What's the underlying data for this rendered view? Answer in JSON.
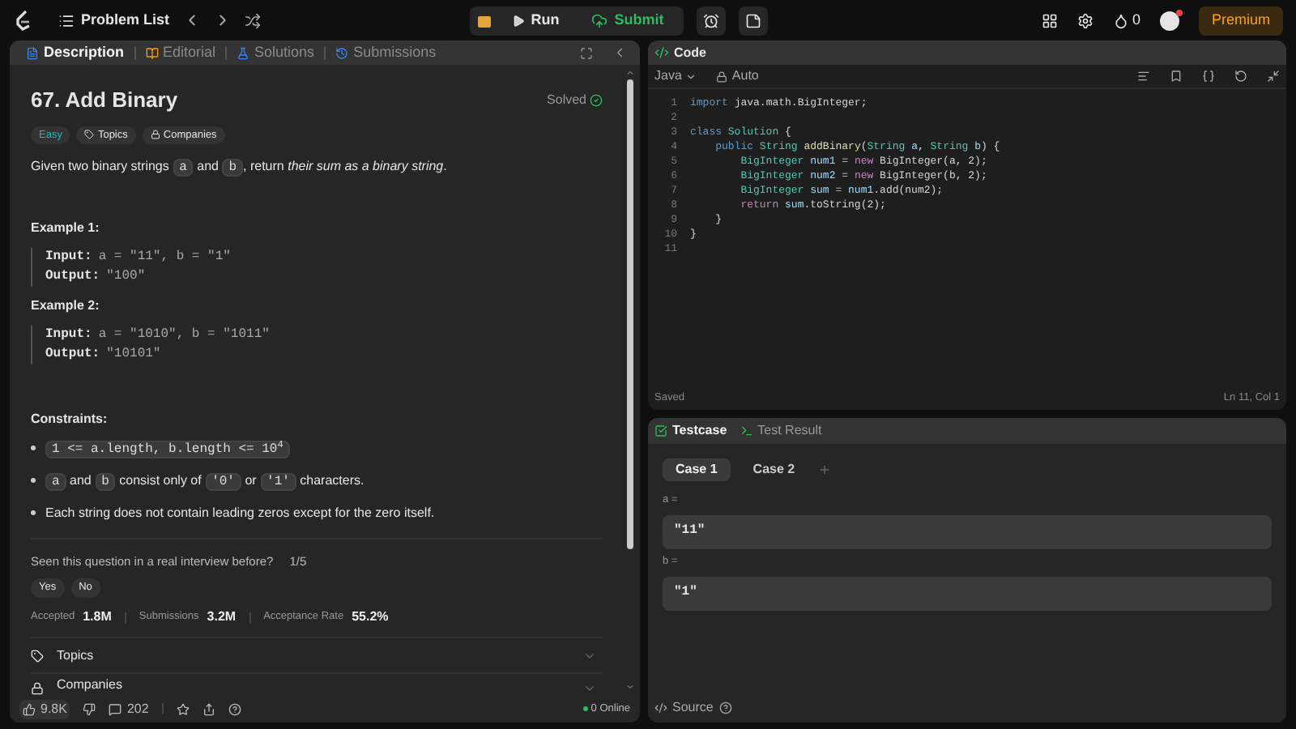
{
  "topbar": {
    "nav_title": "Problem List",
    "run": "Run",
    "submit": "Submit",
    "streak": "0",
    "premium": "Premium",
    "notification_dot": true
  },
  "description_panel": {
    "tabs": [
      {
        "label": "Description",
        "selected": true
      },
      {
        "label": "Editorial",
        "selected": false
      },
      {
        "label": "Solutions",
        "selected": false
      },
      {
        "label": "Submissions",
        "selected": false
      }
    ],
    "title": "67. Add Binary",
    "status": "Solved",
    "difficulty": "Easy",
    "tags": [
      "Topics",
      "Companies"
    ],
    "statement": [
      {
        "kind": "text",
        "text": "Given two binary strings "
      },
      {
        "kind": "code",
        "text": "a"
      },
      {
        "kind": "text",
        "text": " and "
      },
      {
        "kind": "code",
        "text": "b"
      },
      {
        "kind": "text",
        "text": ", return "
      },
      {
        "kind": "em",
        "text": "their sum as a binary string"
      },
      {
        "kind": "text",
        "text": "."
      }
    ],
    "examples": [
      {
        "heading": "Example 1:",
        "rows": [
          {
            "label": "Input:",
            "value": "a = \"11\", b = \"1\""
          },
          {
            "label": "Output:",
            "value": "\"100\""
          }
        ]
      },
      {
        "heading": "Example 2:",
        "rows": [
          {
            "label": "Input:",
            "value": "a = \"1010\", b = \"1011\""
          },
          {
            "label": "Output:",
            "value": "\"10101\""
          }
        ]
      }
    ],
    "constraints_heading": "Constraints:",
    "constraints": [
      [
        {
          "kind": "code",
          "text": "1 <= a.length, b.length <= 10$^{4}$"
        }
      ],
      [
        {
          "kind": "code",
          "text": "a"
        },
        {
          "kind": "text",
          "text": " and "
        },
        {
          "kind": "code",
          "text": "b"
        },
        {
          "kind": "text",
          "text": " consist only of "
        },
        {
          "kind": "code",
          "text": "'0'"
        },
        {
          "kind": "text",
          "text": " or "
        },
        {
          "kind": "code",
          "text": "'1'"
        },
        {
          "kind": "text",
          "text": " characters."
        }
      ],
      [
        {
          "kind": "text",
          "text": "Each string does not contain leading zeros except for the zero itself."
        }
      ]
    ],
    "interview_question": "Seen this question in a real interview before?",
    "interview_count": "1/5",
    "answers": [
      "Yes",
      "No"
    ],
    "stats": [
      {
        "label": "Accepted",
        "value": "1.8M"
      },
      {
        "label": "Submissions",
        "value": "3.2M"
      },
      {
        "label": "Acceptance Rate",
        "value": "55.2%"
      }
    ],
    "sections": [
      {
        "label": "Topics",
        "kind": "tag"
      },
      {
        "label": "Companies",
        "kind": "lock"
      }
    ],
    "footer": {
      "likes": "9.8K",
      "comments": "202",
      "online": "0 Online"
    }
  },
  "code_panel": {
    "title": "Code",
    "language": "Java",
    "mode": "Auto",
    "lines": [
      {
        "number": "1",
        "tokens": [
          {
            "kind": "kw",
            "text": "import "
          },
          {
            "kind": "plain",
            "text": "java.math.BigInteger;"
          }
        ]
      },
      {
        "number": "2"
      },
      {
        "number": "3",
        "tokens": [
          {
            "kind": "kw",
            "text": "class "
          },
          {
            "kind": "type",
            "text": "Solution"
          },
          {
            "kind": "plain",
            "text": " {"
          }
        ]
      },
      {
        "number": "4",
        "tokens": [
          {
            "kind": "kw",
            "text": "    public "
          },
          {
            "kind": "type",
            "text": "String "
          },
          {
            "kind": "method",
            "text": "addBinary"
          },
          {
            "kind": "plain",
            "text": "("
          },
          {
            "kind": "type",
            "text": "String "
          },
          {
            "kind": "var",
            "text": "a"
          },
          {
            "kind": "plain",
            "text": ", "
          },
          {
            "kind": "type",
            "text": "String "
          },
          {
            "kind": "var",
            "text": "b"
          },
          {
            "kind": "plain",
            "text": ") {"
          }
        ]
      },
      {
        "number": "5",
        "tokens": [
          {
            "kind": "type",
            "text": "        BigInteger "
          },
          {
            "kind": "var",
            "text": "num1"
          },
          {
            "kind": "plain",
            "text": " = "
          },
          {
            "kind": "ctl",
            "text": "new "
          },
          {
            "kind": "plain",
            "text": "BigInteger(a, 2);"
          }
        ]
      },
      {
        "number": "6",
        "tokens": [
          {
            "kind": "type",
            "text": "        BigInteger "
          },
          {
            "kind": "var",
            "text": "num2"
          },
          {
            "kind": "plain",
            "text": " = "
          },
          {
            "kind": "ctl",
            "text": "new "
          },
          {
            "kind": "plain",
            "text": "BigInteger(b, 2);"
          }
        ]
      },
      {
        "number": "7",
        "tokens": [
          {
            "kind": "type",
            "text": "        BigInteger "
          },
          {
            "kind": "var",
            "text": "sum"
          },
          {
            "kind": "plain",
            "text": " = "
          },
          {
            "kind": "var",
            "text": "num1"
          },
          {
            "kind": "plain",
            "text": ".add(num2);"
          }
        ]
      },
      {
        "number": "8",
        "tokens": [
          {
            "kind": "ctl",
            "text": "        return "
          },
          {
            "kind": "var",
            "text": "sum"
          },
          {
            "kind": "plain",
            "text": ".toString(2);"
          }
        ]
      },
      {
        "number": "9",
        "tokens": [
          {
            "kind": "plain",
            "text": "    }"
          }
        ]
      },
      {
        "number": "10",
        "tokens": [
          {
            "kind": "plain",
            "text": "}"
          }
        ]
      },
      {
        "number": "11"
      }
    ],
    "status": "Saved",
    "cursor": "Ln 11, Col 1"
  },
  "testcase_panel": {
    "tabs": [
      {
        "label": "Testcase",
        "selected": true
      },
      {
        "label": "Test Result",
        "selected": false
      }
    ],
    "cases": [
      {
        "label": "Case 1",
        "selected": true
      },
      {
        "label": "Case 2",
        "selected": false
      }
    ],
    "params": [
      {
        "name": "a =",
        "value": "\"11\""
      },
      {
        "name": "b =",
        "value": "\"1\""
      }
    ],
    "source": "Source"
  }
}
